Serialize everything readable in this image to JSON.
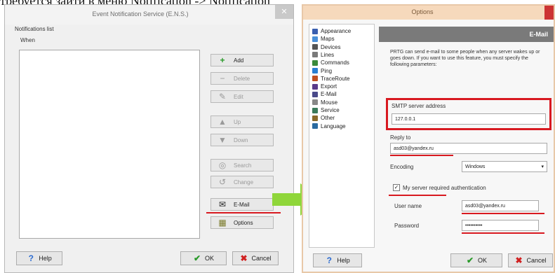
{
  "caption": "требуется зайти в меню Notification -> Notification",
  "left": {
    "title": "Event Notification Service (E.N.S.)",
    "close": "✕",
    "list_label": "Notifications list",
    "column_label": "When",
    "buttons": [
      {
        "label": "Add",
        "icon": "plus-icon"
      },
      {
        "label": "Delete",
        "icon": "minus-icon"
      },
      {
        "label": "Edit",
        "icon": "edit-icon"
      },
      {
        "label": "Up",
        "icon": "arrow-up-icon"
      },
      {
        "label": "Down",
        "icon": "arrow-down-icon"
      },
      {
        "label": "Search",
        "icon": "binoculars-icon"
      },
      {
        "label": "Change",
        "icon": "change-icon"
      },
      {
        "label": "E-Mail",
        "icon": "email-icon"
      },
      {
        "label": "Options",
        "icon": "options-icon"
      }
    ],
    "help": "Help",
    "ok": "OK",
    "cancel": "Cancel"
  },
  "right": {
    "title": "Options",
    "nav": [
      {
        "label": "Appearance",
        "color": "#3a5fb0"
      },
      {
        "label": "Maps",
        "color": "#4a90d9"
      },
      {
        "label": "Devices",
        "color": "#555555"
      },
      {
        "label": "Lines",
        "color": "#7a7a7a"
      },
      {
        "label": "Commands",
        "color": "#3a8a3a"
      },
      {
        "label": "Ping",
        "color": "#2a7fd0"
      },
      {
        "label": "TraceRoute",
        "color": "#c05020"
      },
      {
        "label": "Export",
        "color": "#5a3a8a"
      },
      {
        "label": "E-Mail",
        "color": "#4a4a8a"
      },
      {
        "label": "Mouse",
        "color": "#888888"
      },
      {
        "label": "Service",
        "color": "#3a7a5a"
      },
      {
        "label": "Other",
        "color": "#8a6a2a"
      },
      {
        "label": "Language",
        "color": "#2a6aa0"
      }
    ],
    "header": "E-Mail",
    "description": "PRTG can send e-mail to some people when any server wakes up or goes down. If you want to use this feature, you must specify the following parameters:",
    "smtp_label": "SMTP server address",
    "smtp_value": "127.0.0.1",
    "reply_label": "Reply to",
    "reply_value": "asd03@yandex.ru",
    "encoding_label": "Encoding",
    "encoding_value": "Windows",
    "auth_label": "My server required authentication",
    "user_label": "User name",
    "user_value": "asd03@yandex.ru",
    "password_label": "Password",
    "password_value": "••••••••••",
    "help": "Help",
    "ok": "OK",
    "cancel": "Cancel"
  },
  "colors": {
    "highlight": "#d81920",
    "arrow": "#8fd63a"
  }
}
